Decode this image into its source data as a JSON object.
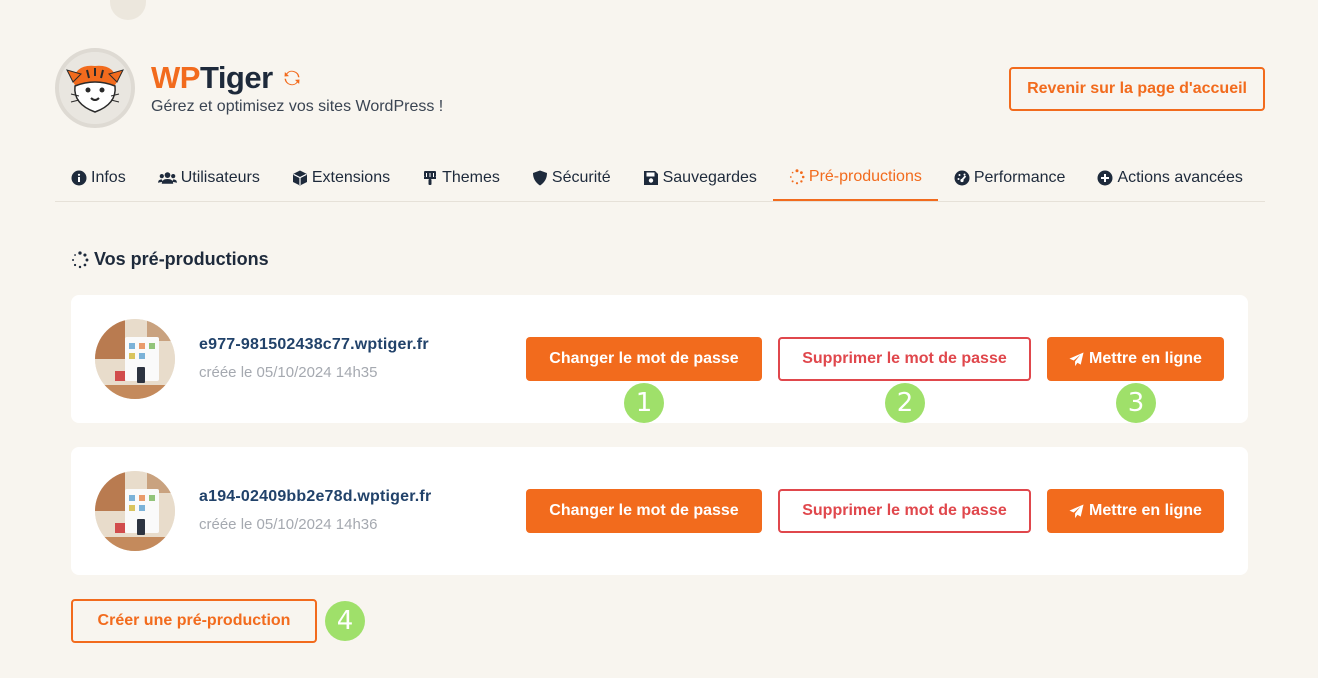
{
  "brand": {
    "name_part1": "WP",
    "name_part2": "Tiger",
    "tagline": "Gérez et optimisez vos sites WordPress !",
    "accent": "#f26b1d"
  },
  "header": {
    "home_button": "Revenir sur la page d'accueil"
  },
  "tabs": [
    {
      "label": "Infos",
      "icon": "info-circle-icon"
    },
    {
      "label": "Utilisateurs",
      "icon": "users-icon"
    },
    {
      "label": "Extensions",
      "icon": "cube-icon"
    },
    {
      "label": "Themes",
      "icon": "paint-roller-icon"
    },
    {
      "label": "Sécurité",
      "icon": "shield-icon"
    },
    {
      "label": "Sauvegardes",
      "icon": "floppy-disk-icon"
    },
    {
      "label": "Pré-productions",
      "icon": "spinner-icon",
      "active": true
    },
    {
      "label": "Performance",
      "icon": "gauge-icon"
    },
    {
      "label": "Actions avancées",
      "icon": "plus-circle-icon"
    }
  ],
  "section": {
    "title": "Vos pré-productions"
  },
  "preprods": [
    {
      "url": "e977-981502438c77.wptiger.fr",
      "created": "créée le 05/10/2024 14h35"
    },
    {
      "url": "a194-02409bb2e78d.wptiger.fr",
      "created": "créée le 05/10/2024 14h36"
    }
  ],
  "actions": {
    "change_password": "Changer le mot de passe",
    "delete_password": "Supprimer le mot de passe",
    "publish": "Mettre en ligne",
    "create": "Créer une pré-production"
  },
  "markers": [
    "1",
    "2",
    "3",
    "4"
  ]
}
